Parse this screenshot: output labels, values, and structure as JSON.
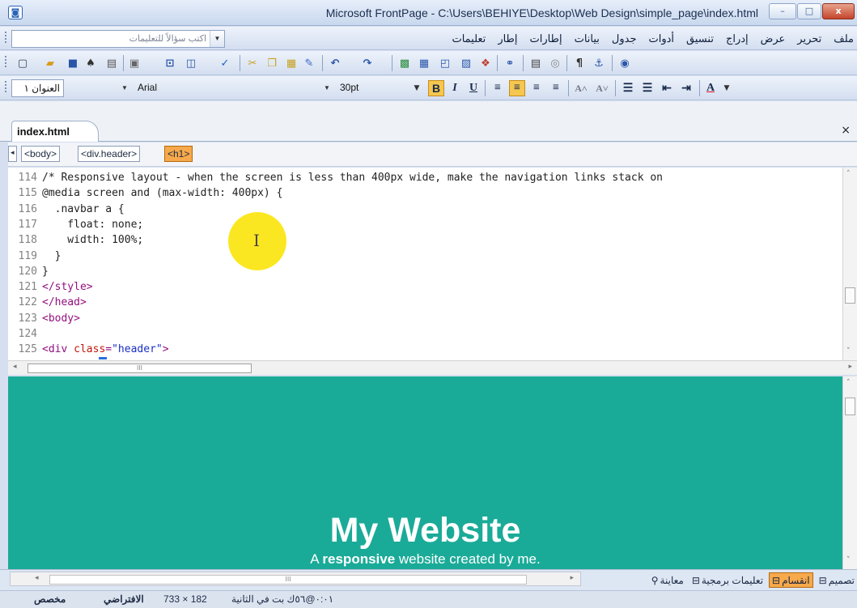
{
  "window": {
    "title": "Microsoft FrontPage - C:\\Users\\BEHIYE\\Desktop\\Web Design\\simple_page\\index.html",
    "min": "–",
    "max": "□",
    "close": "x"
  },
  "menu": {
    "items": [
      "ملف",
      "تحرير",
      "عرض",
      "إدراج",
      "تنسيق",
      "أدوات",
      "جدول",
      "بيانات",
      "إطارات",
      "إطار",
      "تعليمات"
    ],
    "ask_placeholder": "اكتب سؤالاً للتعليمات"
  },
  "format_bar": {
    "style": "العنوان ١",
    "font": "Arial",
    "size": "30pt",
    "bold": "B",
    "italic": "I",
    "underline": "U",
    "active": "align-center"
  },
  "document": {
    "tab": "index.html",
    "close": "×",
    "breadcrumb": [
      "<body>",
      "<div.header>",
      "<h1>"
    ]
  },
  "code": {
    "lines": [
      {
        "num": "114",
        "text": "/* Responsive layout - when the screen is less than 400px wide, make the navigation links stack on"
      },
      {
        "num": "115",
        "text": "@media screen and (max-width: 400px) {"
      },
      {
        "num": "116",
        "text": "  .navbar a {"
      },
      {
        "num": "117",
        "text": "    float: none;"
      },
      {
        "num": "118",
        "text": "    width: 100%;"
      },
      {
        "num": "119",
        "text": "  }"
      },
      {
        "num": "120",
        "text": "}"
      },
      {
        "num": "121",
        "text": "</style>"
      },
      {
        "num": "122",
        "text": "</head>"
      },
      {
        "num": "123",
        "text": "<body>"
      },
      {
        "num": "124",
        "text": ""
      },
      {
        "num": "125",
        "tag_open": "<div ",
        "attr": "class",
        "eq": "=",
        "value": "\"header\"",
        "tag_close": ">"
      }
    ],
    "tag_lines": [
      "121",
      "122",
      "123"
    ]
  },
  "preview": {
    "heading": "My Website",
    "sub_prefix": "A ",
    "sub_bold": "responsive",
    "sub_suffix": " website created by me.",
    "background": "#1aab98"
  },
  "views": [
    {
      "label": "تصميم",
      "icon": "design-view-icon",
      "active": false
    },
    {
      "label": "انقسام",
      "icon": "split-view-icon",
      "active": true
    },
    {
      "label": "تعليمات برمجية",
      "icon": "code-view-icon",
      "active": false
    },
    {
      "label": "معاينة",
      "icon": "preview-view-icon",
      "active": false
    }
  ],
  "status": {
    "time": "٠:٠١@٥٦ك بت في الثانية",
    "size": "733 × 182",
    "default": "الافتراضي",
    "custom": "مخصص"
  },
  "colors": {
    "accent": "#f7a94b",
    "tag": "#930f80",
    "attr": "#c0170c",
    "value": "#1a2fc4"
  }
}
